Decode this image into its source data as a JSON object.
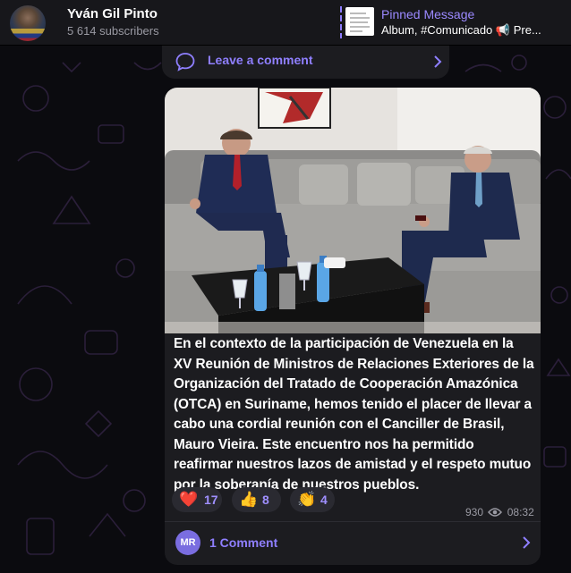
{
  "header": {
    "channel_name": "Yván Gil Pinto",
    "subscribers": "5 614 subscribers",
    "avatar_icon": "channel-avatar",
    "pinned": {
      "title": "Pinned Message",
      "text": "Album, #Comunicado",
      "speaker_icon": "📢",
      "text_suffix": " Pre..."
    }
  },
  "leave_comment": {
    "label": "Leave a comment",
    "icon": "comment-bubble-icon"
  },
  "post": {
    "photo_description_icon": "photo",
    "caption": "En el contexto de la participación de Venezuela en la XV Reunión de Ministros de Relaciones Exteriores de la Organización del Tratado de Cooperación Amazónica (OTCA) en Suriname, hemos tenido el placer de llevar a cabo una cordial reunión con el Canciller de Brasil, Mauro Vieira. Este encuentro nos ha permitido reafirmar nuestros lazos de amistad y el respeto mutuo por la soberanía de nuestros pueblos.",
    "reactions": [
      {
        "emoji": "❤️",
        "count": "17"
      },
      {
        "emoji": "👍",
        "count": "8"
      },
      {
        "emoji": "👏",
        "count": "4"
      }
    ],
    "views": "930",
    "time": "08:32",
    "comments": {
      "avatar_initials": "MR",
      "label": "1 Comment"
    }
  },
  "colors": {
    "accent": "#8f7fff",
    "bubble": "#1c1c20",
    "header": "#17171b",
    "background": "#0b0b0f"
  }
}
